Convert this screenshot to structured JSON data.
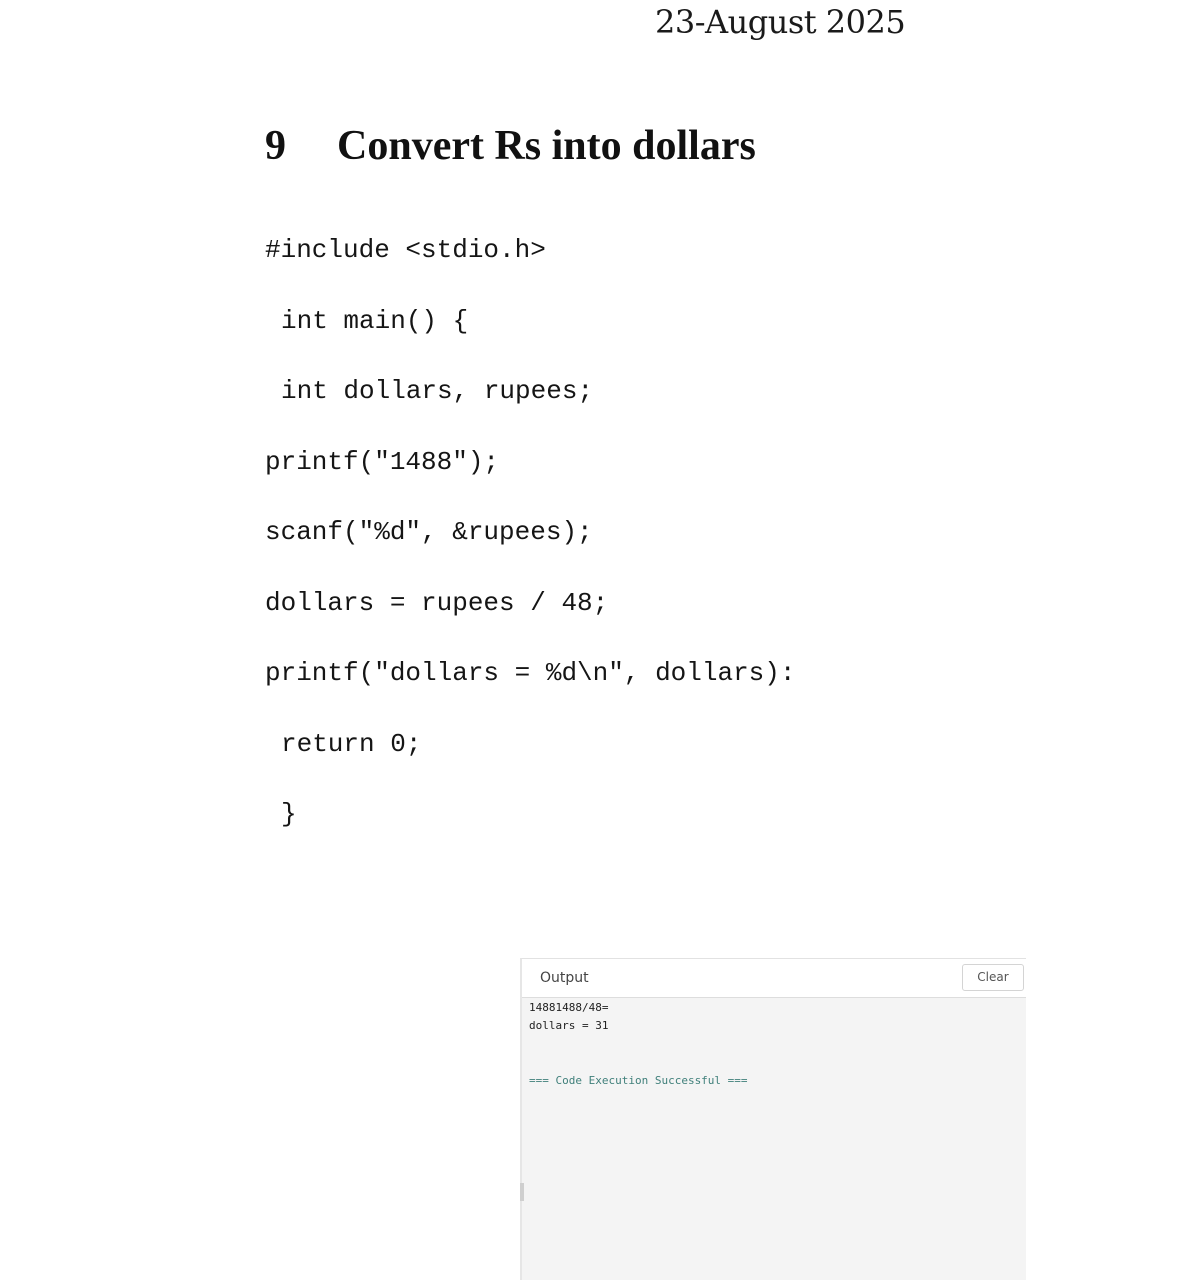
{
  "page": {
    "date": "23-August 2025"
  },
  "section": {
    "number": "9",
    "title": "Convert Rs into dollars"
  },
  "code": {
    "lines": [
      "#include <stdio.h>",
      "int main() {",
      "int dollars, rupees;",
      "printf(\"1488\");",
      "scanf(\"%d\", &rupees);",
      "dollars = rupees / 48;",
      "printf(\"dollars = %d\\n\", dollars):",
      "return 0;",
      "}"
    ]
  },
  "output_panel": {
    "title": "Output",
    "clear_label": "Clear",
    "lines": [
      "14881488/48=",
      "dollars = 31"
    ],
    "status": "=== Code Execution Successful ==="
  },
  "colors": {
    "success_text": "#3f7f7a",
    "panel_background": "#f4f4f4"
  }
}
